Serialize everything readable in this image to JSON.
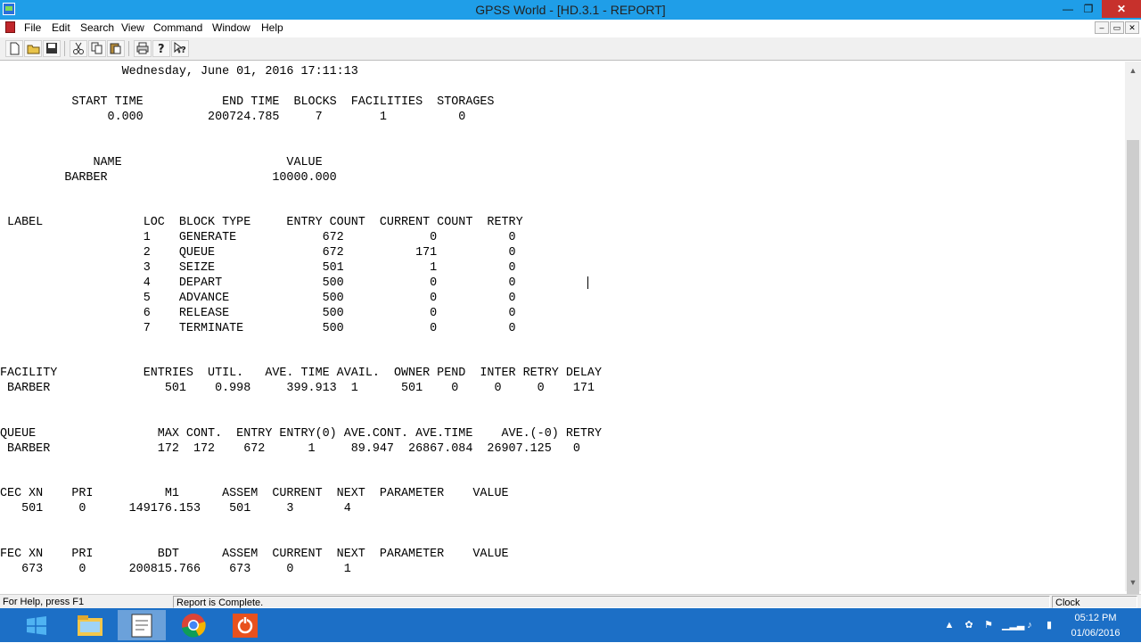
{
  "window": {
    "title": "GPSS World - [HD.3.1  -  REPORT]",
    "minimize_glyph": "—",
    "restore_glyph": "❐",
    "close_glyph": "✕"
  },
  "menu": {
    "items": [
      "File",
      "Edit",
      "Search",
      "View",
      "Command",
      "Window",
      "Help"
    ]
  },
  "mdi_controls": [
    "–",
    "▭",
    "✕"
  ],
  "toolbar": {
    "buttons": [
      "new-file-icon",
      "open-folder-icon",
      "save-icon",
      "cut-icon",
      "copy-icon",
      "paste-icon",
      "print-icon",
      "help-icon",
      "context-help-icon"
    ]
  },
  "report": {
    "lines": [
      "                 Wednesday, June 01, 2016 17:11:13",
      "",
      "          START TIME           END TIME  BLOCKS  FACILITIES  STORAGES",
      "               0.000         200724.785     7        1          0",
      "",
      "",
      "             NAME                       VALUE",
      "         BARBER                       10000.000",
      "",
      "",
      " LABEL              LOC  BLOCK TYPE     ENTRY COUNT  CURRENT COUNT  RETRY",
      "                    1    GENERATE            672            0          0",
      "                    2    QUEUE               672          171          0",
      "                    3    SEIZE               501            1          0",
      "                    4    DEPART              500            0          0",
      "                    5    ADVANCE             500            0          0",
      "                    6    RELEASE             500            0          0",
      "                    7    TERMINATE           500            0          0",
      "",
      "",
      "FACILITY            ENTRIES  UTIL.   AVE. TIME AVAIL.  OWNER PEND  INTER RETRY DELAY",
      " BARBER                501    0.998     399.913  1      501    0     0     0    171",
      "",
      "",
      "QUEUE                 MAX CONT.  ENTRY ENTRY(0) AVE.CONT. AVE.TIME    AVE.(-0) RETRY",
      " BARBER               172  172    672      1     89.947  26867.084  26907.125   0",
      "",
      "",
      "CEC XN    PRI          M1      ASSEM  CURRENT  NEXT  PARAMETER    VALUE",
      "   501     0      149176.153    501     3       4",
      "",
      "",
      "FEC XN    PRI         BDT      ASSEM  CURRENT  NEXT  PARAMETER    VALUE",
      "   673     0      200815.766    673     0       1"
    ]
  },
  "status": {
    "help": "For Help, press F1",
    "message": "Report is Complete.",
    "mode": "Clock"
  },
  "taskbar": {
    "apps": [
      "file-explorer-icon",
      "gpss-world-icon",
      "chrome-icon",
      "office-icon"
    ],
    "time": "05:12 PM",
    "date": "01/06/2016"
  },
  "colors": {
    "titlebar": "#1f9ee8",
    "taskbar": "#1c6fc6",
    "close_button": "#c7312c"
  }
}
